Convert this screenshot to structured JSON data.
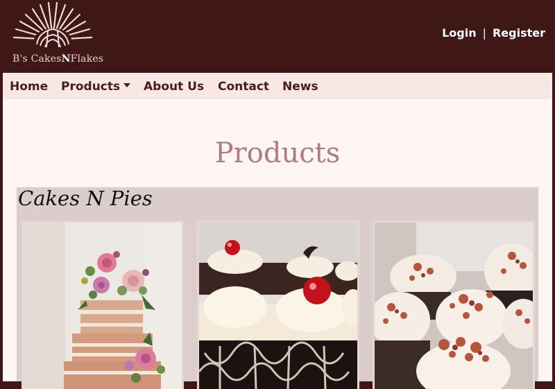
{
  "brand": {
    "name_part1": "B's Cakes",
    "name_part2": "N",
    "name_part3": "Flakes"
  },
  "auth": {
    "login": "Login",
    "separator": "|",
    "register": "Register"
  },
  "nav": {
    "items": [
      {
        "label": "Home"
      },
      {
        "label": "Products"
      },
      {
        "label": "About Us"
      },
      {
        "label": "Contact"
      },
      {
        "label": "News"
      }
    ]
  },
  "page": {
    "title": "Products"
  },
  "section": {
    "title": "Cakes N Pies",
    "products": [
      {
        "image": "naked-floral-cake-photo"
      },
      {
        "image": "black-forest-cake-photo"
      },
      {
        "image": "bacon-cupcakes-photo"
      }
    ]
  },
  "colors": {
    "header_bg": "#3f1716",
    "nav_bg": "#f7e8e6",
    "main_bg": "#fff6f4",
    "title_color": "#b07a84",
    "section_bg": "#dccdcd"
  }
}
